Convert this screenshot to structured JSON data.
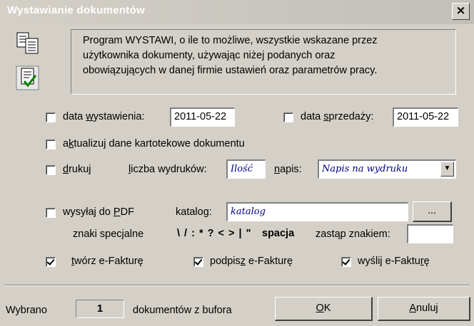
{
  "window": {
    "title": "Wystawianie dokumentów",
    "close_label": "×"
  },
  "info": {
    "line1": "Program WYSTAWI, o ile to możliwe, wszystkie wskazane przez",
    "line2": "użytkownika dokumenty, używając niżej podanych oraz",
    "line3": "obowiązujących w danej firmie ustawień oraz parametrów pracy."
  },
  "issue_date": {
    "label_pre": "data ",
    "label_ul": "w",
    "label_post": "ystawienia:",
    "checked": false,
    "value": "2011-05-22"
  },
  "sale_date": {
    "label_pre": "data ",
    "label_ul": "s",
    "label_post": "przedaży:",
    "checked": false,
    "value": "2011-05-22"
  },
  "update": {
    "label_pre": "a",
    "label_ul": "k",
    "label_post": "tualizuj dane kartotekowe dokumentu",
    "checked": false
  },
  "print": {
    "label_ul": "d",
    "label_post": "rukuj",
    "checked": false,
    "copies_label_ul": "l",
    "copies_label_post": "iczba wydruków:",
    "copies_placeholder": "Ilość",
    "caption_label_ul": "n",
    "caption_label_post": "apis:",
    "caption_placeholder": "Napis na wydruku",
    "dropdown_arrow": "▼"
  },
  "pdf": {
    "label_pre": "wysyłaj do ",
    "label_ul": "P",
    "label_post": "DF",
    "checked": false,
    "folder_label": "katalog:",
    "folder_placeholder": "katalog",
    "browse_label": "...",
    "special_label": "znaki specjalne",
    "special_chars": "\\ / : * ? < > | \"",
    "special_space": "spacja",
    "replace_label": "zastąp znakiem:"
  },
  "efaktura": {
    "create": {
      "label_ul": "t",
      "label_post": "wórz e-Fakturę",
      "checked": true
    },
    "sign": {
      "label_pre": "podpis",
      "label_ul": "z",
      "label_post": " e-Fakturę",
      "checked": true
    },
    "send": {
      "label_pre": "wyślij e-Faktu",
      "label_ul": "r",
      "label_post": "ę",
      "checked": true
    }
  },
  "footer": {
    "selected_label": "Wybrano",
    "selected_count": "1",
    "selected_suffix": "dokumentów z bufora",
    "ok_ul": "O",
    "ok_post": "K",
    "cancel_ul": "A",
    "cancel_post": "nuluj"
  }
}
